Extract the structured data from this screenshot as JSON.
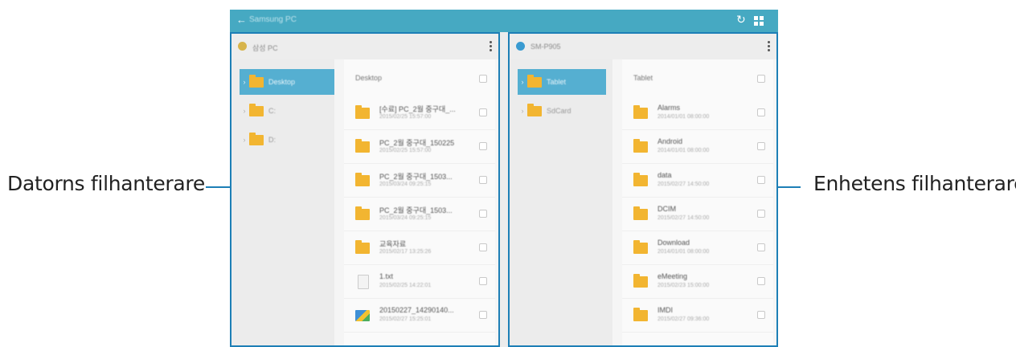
{
  "callouts": {
    "left_label": "Datorns filhanterare",
    "right_label": "Enhetens filhanterare"
  },
  "app_bar": {
    "title": "Samsung PC",
    "color": "#46a9c2",
    "icons": [
      "back-arrow-icon",
      "refresh-icon",
      "grid-view-icon"
    ]
  },
  "left_pane": {
    "device_name": "삼성 PC",
    "device_color": "#d7b44b",
    "tree": [
      {
        "label": "Desktop",
        "selected": true
      },
      {
        "label": "C:",
        "selected": false
      },
      {
        "label": "D:",
        "selected": false
      }
    ],
    "list_title": "Desktop",
    "items": [
      {
        "name": "[수료] PC_2월 중구대_...",
        "date": "2015/02/25 15:57:00",
        "type": "folder"
      },
      {
        "name": "PC_2월 중구대_150225",
        "date": "2015/02/25 15:57:00",
        "type": "folder"
      },
      {
        "name": "PC_2월 중구대_1503...",
        "date": "2015/03/24 09:25:15",
        "type": "folder"
      },
      {
        "name": "PC_2월 중구대_1503...",
        "date": "2015/03/24 09:25:15",
        "type": "folder"
      },
      {
        "name": "교육자료",
        "date": "2015/02/17 13:25:26",
        "type": "folder"
      },
      {
        "name": "1.txt",
        "date": "2015/02/25 14:22:01",
        "type": "file"
      },
      {
        "name": "20150227_14290140...",
        "date": "2015/02/27 15:25:01",
        "type": "image"
      }
    ]
  },
  "right_pane": {
    "device_name": "SM-P905",
    "device_color": "#3a9bd1",
    "tree": [
      {
        "label": "Tablet",
        "selected": true
      },
      {
        "label": "SdCard",
        "selected": false
      }
    ],
    "list_title": "Tablet",
    "items": [
      {
        "name": "Alarms",
        "date": "2014/01/01 08:00:00",
        "type": "folder"
      },
      {
        "name": "Android",
        "date": "2014/01/01 08:00:00",
        "type": "folder"
      },
      {
        "name": "data",
        "date": "2015/02/27 14:50:00",
        "type": "folder"
      },
      {
        "name": "DCIM",
        "date": "2015/02/27 14:50:00",
        "type": "folder"
      },
      {
        "name": "Download",
        "date": "2014/01/01 08:00:00",
        "type": "folder"
      },
      {
        "name": "eMeeting",
        "date": "2015/02/23 15:00:00",
        "type": "folder"
      },
      {
        "name": "IMDI",
        "date": "2015/02/27 09:36:00",
        "type": "folder"
      }
    ]
  }
}
